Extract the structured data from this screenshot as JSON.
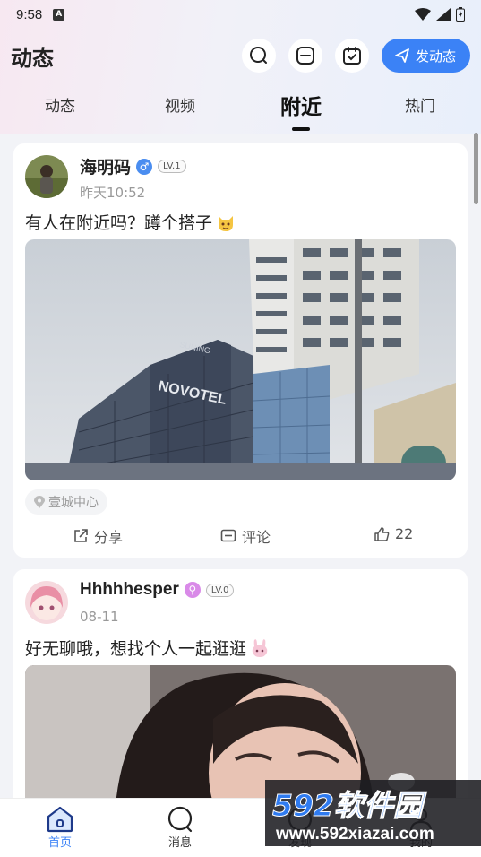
{
  "status_bar": {
    "time": "9:58",
    "badge": "A"
  },
  "header": {
    "title": "动态",
    "post_button": "发动态"
  },
  "tabs": [
    {
      "label": "动态",
      "active": false
    },
    {
      "label": "视频",
      "active": false
    },
    {
      "label": "附近",
      "active": true
    },
    {
      "label": "热门",
      "active": false
    }
  ],
  "posts": [
    {
      "username": "海明码",
      "gender": "male",
      "gender_color": "#4a8df0",
      "level": "LV.1",
      "time": "昨天10:52",
      "text": "有人在附近吗？蹲个搭子",
      "location": "壹城中心",
      "photo_signs": [
        "SUNING",
        "NOVOTEL"
      ],
      "share_label": "分享",
      "comment_label": "评论",
      "likes": "22"
    },
    {
      "username": "Hhhhhesper",
      "gender": "female",
      "gender_color": "#d98ae8",
      "level": "LV.0",
      "time": "08-11",
      "text": "好无聊哦，想找个人一起逛逛"
    }
  ],
  "bottom_nav": [
    {
      "label": "首页",
      "active": true
    },
    {
      "label": "消息",
      "active": false
    },
    {
      "label": "发现",
      "active": false
    },
    {
      "label": "我的",
      "active": false
    }
  ],
  "watermark": {
    "brand": "592软件园",
    "url": "www.592xiazai.com"
  },
  "colors": {
    "accent": "#3b82f6",
    "background": "#f2f3f7"
  }
}
